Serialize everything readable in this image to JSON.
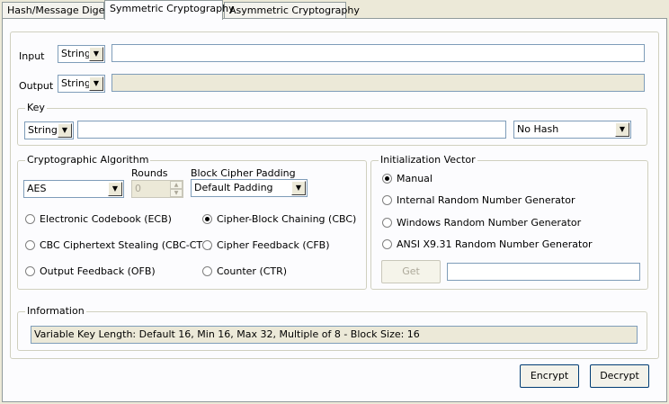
{
  "tabs": [
    "Hash/Message Digest",
    "Symmetric Cryptography",
    "Asymmetric Cryptography"
  ],
  "input": {
    "label": "Input",
    "type": "String",
    "value": ""
  },
  "output": {
    "label": "Output",
    "type": "String",
    "value": ""
  },
  "key": {
    "legend": "Key",
    "type": "String",
    "value": "",
    "hash": "No Hash"
  },
  "algorithm": {
    "legend": "Cryptographic Algorithm",
    "selected": "AES",
    "rounds_label": "Rounds",
    "rounds_value": "0",
    "padding_label": "Block Cipher Padding",
    "padding_value": "Default Padding",
    "modes": [
      {
        "label": "Electronic Codebook (ECB)",
        "selected": false
      },
      {
        "label": "Cipher-Block Chaining (CBC)",
        "selected": true
      },
      {
        "label": "CBC Ciphertext Stealing (CBC-CTS)",
        "selected": false
      },
      {
        "label": "Cipher Feedback (CFB)",
        "selected": false
      },
      {
        "label": "Output Feedback (OFB)",
        "selected": false
      },
      {
        "label": "Counter (CTR)",
        "selected": false
      }
    ]
  },
  "iv": {
    "legend": "Initialization Vector",
    "options": [
      {
        "label": "Manual",
        "selected": true
      },
      {
        "label": "Internal Random Number Generator",
        "selected": false
      },
      {
        "label": "Windows Random Number Generator",
        "selected": false
      },
      {
        "label": "ANSI X9.31 Random Number Generator",
        "selected": false
      }
    ],
    "get_label": "Get",
    "value": ""
  },
  "information": {
    "legend": "Information",
    "text": "Variable Key Length: Default 16, Min 16, Max 32, Multiple of 8 - Block Size: 16"
  },
  "buttons": {
    "encrypt": "Encrypt",
    "decrypt": "Decrypt"
  }
}
